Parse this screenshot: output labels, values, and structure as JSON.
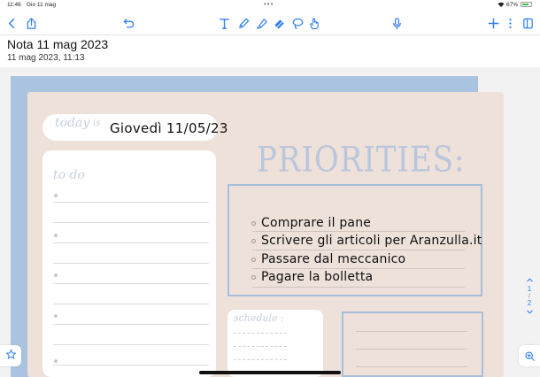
{
  "status_bar": {
    "time": "11:46",
    "date": "Gio 11 mag",
    "battery_percent": "67%",
    "battery_level": 0.67,
    "multitask_indicator": "•••"
  },
  "toolbar": {
    "icons": [
      "chevron-left-icon",
      "share-icon",
      "undo-icon",
      "text-tool-icon",
      "pen-tool-icon",
      "highlighter-tool-icon",
      "eraser-tool-icon",
      "lasso-tool-icon",
      "touch-tool-icon",
      "microphone-icon",
      "add-icon",
      "more-icon",
      "pages-icon"
    ],
    "accent_color": "#2f7ff6"
  },
  "note": {
    "title": "Nota 11 mag 2023",
    "created": "11 mag 2023, 11:13"
  },
  "planner": {
    "today_label": "today",
    "today_is": "is",
    "today_value": "Giovedì 11/05/23",
    "todo_label": "to do",
    "priorities_title": "PRIORITIES:",
    "priorities": [
      "Comprare il pane",
      "Scrivere gli articoli per Aranzulla.it",
      "Passare dal meccanico",
      "Pagare la bolletta"
    ],
    "schedule_label": "schedule :",
    "colors": {
      "blue_sheet": "#aac3e0",
      "beige_sheet": "#ede1d9",
      "frame_blue": "#a7bfdc"
    }
  },
  "pager": {
    "current": "1",
    "total": "2"
  }
}
